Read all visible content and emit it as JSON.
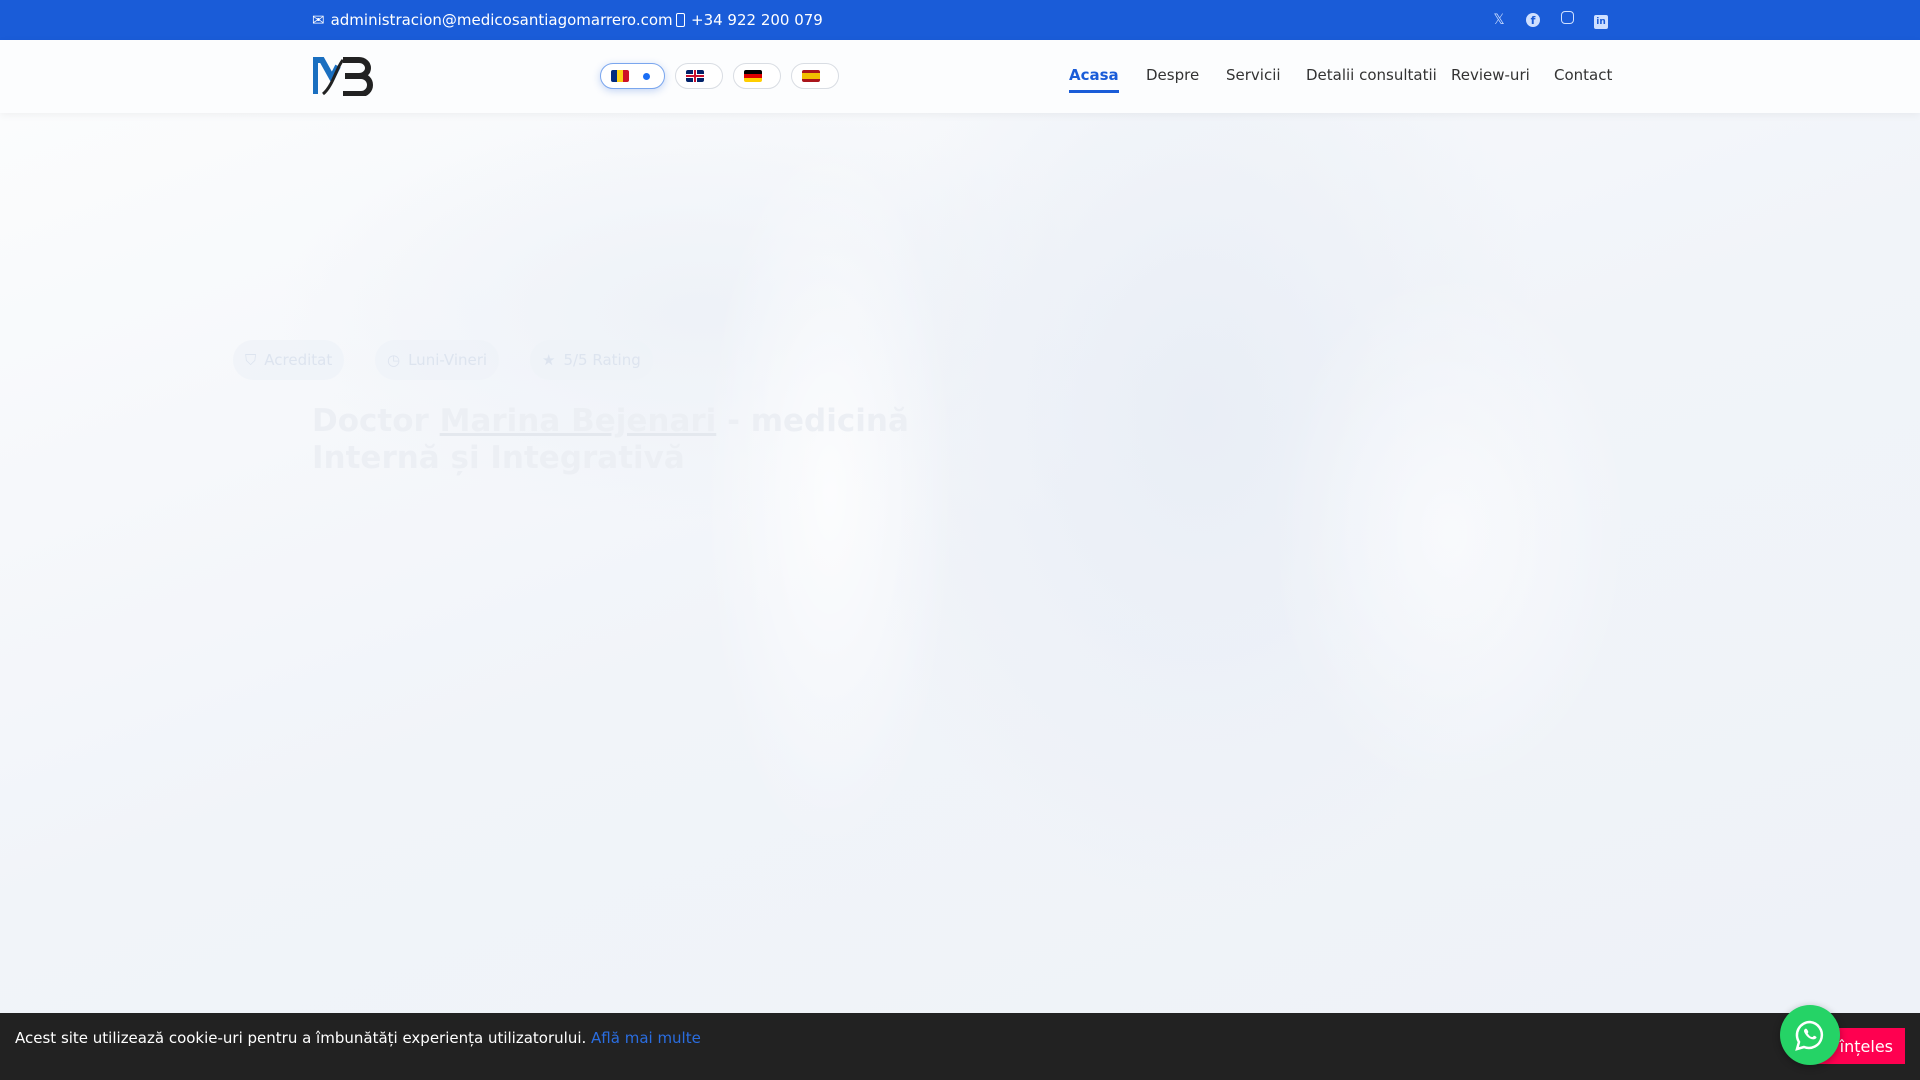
{
  "topbar": {
    "email": "administracion@medicosantiagomarrero.com",
    "phone": "+34 922 200 079",
    "social": [
      "x-icon",
      "facebook-icon",
      "instagram-icon",
      "linkedin-icon"
    ]
  },
  "header": {
    "logo": "MB",
    "languages": [
      {
        "code": "ro",
        "active": true
      },
      {
        "code": "en"
      },
      {
        "code": "de"
      },
      {
        "code": "es"
      }
    ],
    "nav": [
      {
        "label": "Acasa",
        "active": true
      },
      {
        "label": "Despre"
      },
      {
        "label": "Servicii"
      },
      {
        "label": "Detalii consultatii"
      },
      {
        "label": "Review-uri"
      },
      {
        "label": "Contact"
      }
    ]
  },
  "hero": {
    "badges": [
      "Acreditat",
      "Luni-Vineri",
      "5/5 Rating"
    ],
    "title_prefix": "Doctor ",
    "title_name": "Marina Bejenari",
    "title_suffix": " - medicină Internă și Integrativă"
  },
  "cookie": {
    "text": "Acest site utilizează cookie-uri pentru a îmbunătăți experiența utilizatorului. ",
    "link": "Află mai multe",
    "accept": "Am înțeles"
  },
  "colors": {
    "primary": "#1a5cd8",
    "cookie_button": "#ff0050",
    "whatsapp": "#25d366"
  }
}
